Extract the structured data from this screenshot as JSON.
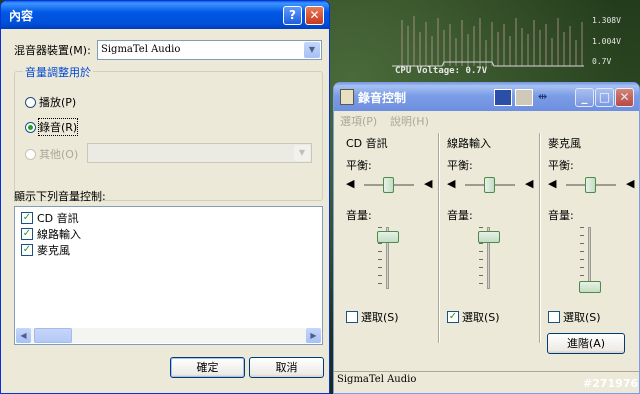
{
  "desktop": {
    "cpu_label": "CPU Voltage: 0.7V",
    "voltage_ticks": [
      "1.308V",
      "1.004V",
      "0.7V"
    ],
    "watermark": "#271976"
  },
  "props_dialog": {
    "title": "內容",
    "help_btn": "?",
    "close_btn": "✕",
    "mixer_device_label": "混音器裝置(M):",
    "mixer_device_value": "SigmaTel Audio",
    "adjust_group_label": "音量調整用於",
    "radio_playback": "播放(P)",
    "radio_record": "錄音(R)",
    "radio_other": "其他(O)",
    "list_label": "顯示下列音量控制:",
    "list_items": [
      "CD 音訊",
      "線路輸入",
      "麥克風"
    ],
    "ok": "確定",
    "cancel": "取消"
  },
  "mixer": {
    "title": "錄音控制",
    "menu_options": "選項(P)",
    "menu_help": "說明(H)",
    "balance_label": "平衡:",
    "volume_label": "音量:",
    "select_label": "選取(S)",
    "advanced": "進階(A)",
    "status": "SigmaTel Audio",
    "channels": [
      {
        "name": "CD 音訊",
        "selected": false,
        "volume": 0.9
      },
      {
        "name": "線路輸入",
        "selected": true,
        "volume": 0.9
      },
      {
        "name": "麥克風",
        "selected": false,
        "volume": 0.1
      }
    ]
  }
}
